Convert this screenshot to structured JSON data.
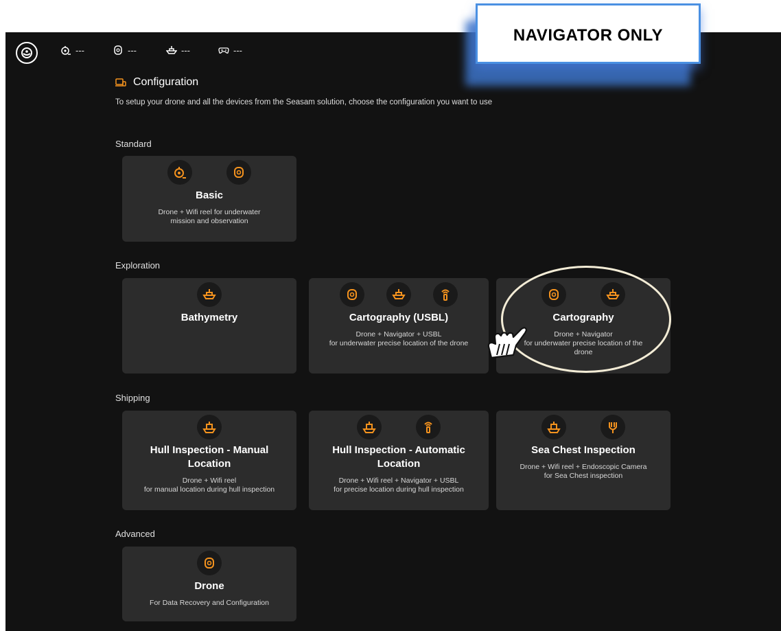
{
  "callout": {
    "text": "NAVIGATOR ONLY"
  },
  "topbar": {
    "statuses": [
      {
        "icon": "reel-icon",
        "value": "---"
      },
      {
        "icon": "drone-icon",
        "value": "---"
      },
      {
        "icon": "navigator-icon",
        "value": "---"
      },
      {
        "icon": "gamepad-icon",
        "value": "---"
      }
    ]
  },
  "page": {
    "title": "Configuration",
    "description": "To setup your drone and all the devices from the Seasam solution, choose the configuration you want to use"
  },
  "sections": {
    "standard": "Standard",
    "exploration": "Exploration",
    "shipping": "Shipping",
    "advanced": "Advanced"
  },
  "cards": {
    "basic": {
      "title": "Basic",
      "desc": "Drone + Wifi reel for underwater mission and observation"
    },
    "bathymetry": {
      "title": "Bathymetry",
      "desc": ""
    },
    "cartography_usbl": {
      "title": "Cartography (USBL)",
      "desc1": "Drone + Navigator + USBL",
      "desc2": "for underwater precise location of the drone"
    },
    "cartography": {
      "title": "Cartography",
      "desc1": "Drone + Navigator",
      "desc2": "for underwater precise location of the drone"
    },
    "hull_manual": {
      "title": "Hull Inspection - Manual Location",
      "desc1": "Drone + Wifi reel",
      "desc2": "for manual location during hull inspection"
    },
    "hull_auto": {
      "title": "Hull Inspection - Automatic Location",
      "desc1": "Drone + Wifi reel + Navigator + USBL",
      "desc2": "for precise location during hull inspection"
    },
    "sea_chest": {
      "title": "Sea Chest Inspection",
      "desc1": "Drone + Wifi reel + Endoscopic Camera",
      "desc2": "for Sea Chest inspection"
    },
    "drone": {
      "title": "Drone",
      "desc": "For Data Recovery and Configuration"
    }
  },
  "colors": {
    "accent": "#f5931e",
    "background": "#121212",
    "card": "#2c2c2c",
    "highlight": "#f3ecd6",
    "callout_border": "#4a90e2"
  }
}
